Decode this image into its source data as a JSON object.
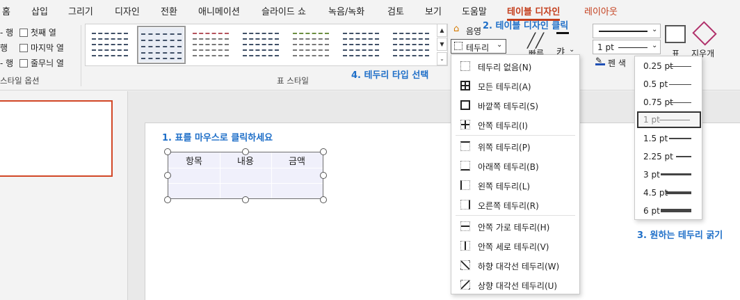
{
  "menu": {
    "tabs": [
      {
        "label": "홈"
      },
      {
        "label": "삽입"
      },
      {
        "label": "그리기"
      },
      {
        "label": "디자인"
      },
      {
        "label": "전환"
      },
      {
        "label": "애니메이션"
      },
      {
        "label": "슬라이드 쇼"
      },
      {
        "label": "녹음/녹화"
      },
      {
        "label": "검토"
      },
      {
        "label": "보기"
      },
      {
        "label": "도움말"
      },
      {
        "label": "테이블 디자인",
        "active": true
      },
      {
        "label": "레이아웃"
      }
    ]
  },
  "style_options": {
    "left_col": [
      "행",
      "행",
      "행"
    ],
    "right_col": [
      "첫째 열",
      "마지막 열",
      "줄무늬 열"
    ],
    "group_label": "스타일 옵션"
  },
  "table_styles": {
    "group_label": "표 스타일",
    "swatch_colors": [
      "#3f4f66",
      "#3f4f66",
      "#b5525c",
      "#6b8e3f",
      "#3f4f66",
      "#3f4f66",
      "#3f4f66"
    ],
    "shading_label": "음영",
    "borders_label": "테두리"
  },
  "draw_group": {
    "weight_value": "1 pt",
    "pen_color_label": "펜 색",
    "table_label": "표",
    "eraser_label": "지우개",
    "quick_label": "빠른",
    "text_label": "캬"
  },
  "annotations": {
    "step1": "1. 표를 마우스로 클릭하세요",
    "step2": "2. 테이블 디자인 클릭",
    "step3": "3. 원하는 테두리 굵기",
    "step4": "4. 테두리 타입 선택"
  },
  "table": {
    "headers": [
      "항목",
      "내용",
      "금액"
    ]
  },
  "border_menu": {
    "items": [
      {
        "label": "테두리 없음(N)",
        "icon": "no-border-icon"
      },
      {
        "label": "모든 테두리(A)",
        "icon": "all-borders-icon"
      },
      {
        "label": "바깥쪽 테두리(S)",
        "icon": "outside-borders-icon"
      },
      {
        "label": "안쪽 테두리(I)",
        "icon": "inside-borders-icon"
      },
      {
        "label": "위쪽 테두리(P)",
        "icon": "top-border-icon"
      },
      {
        "label": "아래쪽 테두리(B)",
        "icon": "bottom-border-icon"
      },
      {
        "label": "왼쪽 테두리(L)",
        "icon": "left-border-icon"
      },
      {
        "label": "오른쪽 테두리(R)",
        "icon": "right-border-icon"
      },
      {
        "label": "안쪽 가로 테두리(H)",
        "icon": "inside-horizontal-border-icon"
      },
      {
        "label": "안쪽 세로 테두리(V)",
        "icon": "inside-vertical-border-icon"
      },
      {
        "label": "하향 대각선 테두리(W)",
        "icon": "diagonal-down-border-icon"
      },
      {
        "label": "상향 대각선 테두리(U)",
        "icon": "diagonal-up-border-icon"
      }
    ]
  },
  "weight_menu": {
    "items": [
      {
        "label": "0.25 pt",
        "weight_pt": 0.25
      },
      {
        "label": "0.5 pt",
        "weight_pt": 0.5
      },
      {
        "label": "0.75 pt",
        "weight_pt": 0.75
      },
      {
        "label": "1 pt",
        "weight_pt": 1,
        "selected": true
      },
      {
        "label": "1.5 pt",
        "weight_pt": 1.5
      },
      {
        "label": "2.25 pt",
        "weight_pt": 2.25
      },
      {
        "label": "3 pt",
        "weight_pt": 3
      },
      {
        "label": "4.5 pt",
        "weight_pt": 4.5
      },
      {
        "label": "6 pt",
        "weight_pt": 6
      }
    ]
  },
  "colors": {
    "accent": "#c43e1c",
    "annotation": "#1f6fc8"
  }
}
